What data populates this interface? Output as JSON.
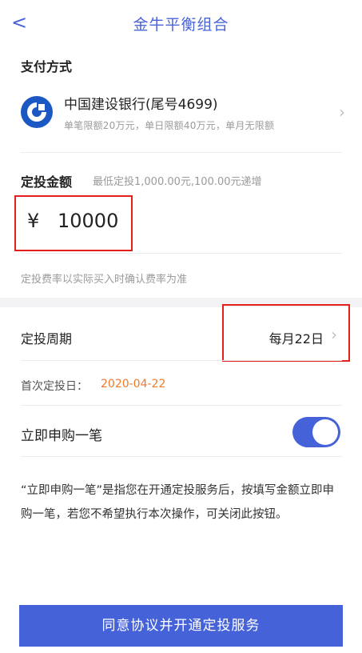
{
  "nav": {
    "title": "金牛平衡组合",
    "back_icon": "<"
  },
  "payment": {
    "section_title": "支付方式",
    "bank_name": "中国建设银行(尾号4699)",
    "limits": "单笔限额20万元，单日限额40万元，单月无限额",
    "chevron": "›"
  },
  "amount": {
    "section_title": "定投金额",
    "hint": "最低定投1,000.00元,100.00元递增",
    "currency_symbol": "¥",
    "value": "10000",
    "fee_note": "定投费率以实际买入时确认费率为准"
  },
  "cycle": {
    "label": "定投周期",
    "value": "每月22日",
    "chevron": "›"
  },
  "first_date": {
    "label": "首次定投日：",
    "value": "2020-04-22"
  },
  "buy_now": {
    "label": "立即申购一笔",
    "enabled": true,
    "description": "“立即申购一笔”是指您在开通定投服务后，按填写金额立即申购一笔，若您不希望执行本次操作，可关闭此按钮。"
  },
  "cta": {
    "label": "同意协议并开通定投服务"
  },
  "colors": {
    "accent": "#4562d8",
    "highlight_border": "#e3201b",
    "date": "#f07a2a"
  }
}
